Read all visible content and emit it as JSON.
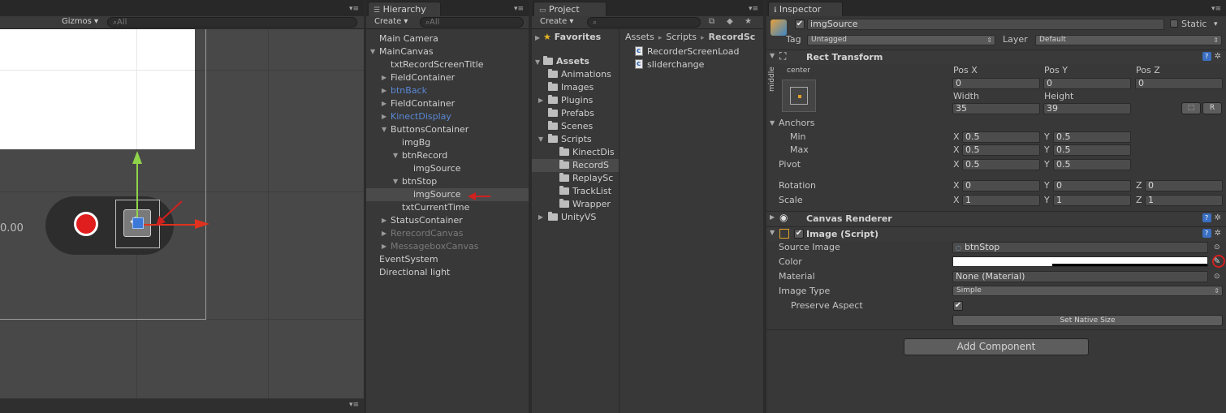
{
  "scene": {
    "gizmos_label": "Gizmos",
    "search_placeholder": "All",
    "time_text": "0.00"
  },
  "hierarchy": {
    "tab_label": "Hierarchy",
    "create_label": "Create",
    "search_placeholder": "All",
    "items": [
      {
        "label": "Main Camera",
        "indent": 0,
        "arrow": "",
        "style": ""
      },
      {
        "label": "MainCanvas",
        "indent": 0,
        "arrow": "▼",
        "style": ""
      },
      {
        "label": "txtRecordScreenTitle",
        "indent": 1,
        "arrow": "",
        "style": ""
      },
      {
        "label": "FieldContainer",
        "indent": 1,
        "arrow": "▶",
        "style": ""
      },
      {
        "label": "btnBack",
        "indent": 1,
        "arrow": "▶",
        "style": "blue"
      },
      {
        "label": "FieldContainer",
        "indent": 1,
        "arrow": "▶",
        "style": ""
      },
      {
        "label": "KinectDisplay",
        "indent": 1,
        "arrow": "▶",
        "style": "blue"
      },
      {
        "label": "ButtonsContainer",
        "indent": 1,
        "arrow": "▼",
        "style": ""
      },
      {
        "label": "imgBg",
        "indent": 2,
        "arrow": "",
        "style": ""
      },
      {
        "label": "btnRecord",
        "indent": 2,
        "arrow": "▼",
        "style": ""
      },
      {
        "label": "imgSource",
        "indent": 3,
        "arrow": "",
        "style": ""
      },
      {
        "label": "btnStop",
        "indent": 2,
        "arrow": "▼",
        "style": ""
      },
      {
        "label": "imgSource",
        "indent": 3,
        "arrow": "",
        "style": "selected"
      },
      {
        "label": "txtCurrentTime",
        "indent": 2,
        "arrow": "",
        "style": ""
      },
      {
        "label": "StatusContainer",
        "indent": 1,
        "arrow": "▶",
        "style": ""
      },
      {
        "label": "RerecordCanvas",
        "indent": 1,
        "arrow": "▶",
        "style": "dim"
      },
      {
        "label": "MessageboxCanvas",
        "indent": 1,
        "arrow": "▶",
        "style": "dim"
      },
      {
        "label": "EventSystem",
        "indent": 0,
        "arrow": "",
        "style": ""
      },
      {
        "label": "Directional light",
        "indent": 0,
        "arrow": "",
        "style": ""
      }
    ]
  },
  "project": {
    "tab_label": "Project",
    "create_label": "Create",
    "favorites_label": "Favorites",
    "assets_label": "Assets",
    "folders": [
      {
        "label": "Animations",
        "indent": 1,
        "arrow": ""
      },
      {
        "label": "Images",
        "indent": 1,
        "arrow": ""
      },
      {
        "label": "Plugins",
        "indent": 1,
        "arrow": "▶"
      },
      {
        "label": "Prefabs",
        "indent": 1,
        "arrow": ""
      },
      {
        "label": "Scenes",
        "indent": 1,
        "arrow": ""
      },
      {
        "label": "Scripts",
        "indent": 1,
        "arrow": "▼"
      },
      {
        "label": "KinectDis",
        "indent": 2,
        "arrow": ""
      },
      {
        "label": "RecordS",
        "indent": 2,
        "arrow": "",
        "selected": true
      },
      {
        "label": "ReplaySc",
        "indent": 2,
        "arrow": ""
      },
      {
        "label": "TrackList",
        "indent": 2,
        "arrow": ""
      },
      {
        "label": "Wrapper",
        "indent": 2,
        "arrow": ""
      },
      {
        "label": "UnityVS",
        "indent": 1,
        "arrow": "▶"
      }
    ],
    "breadcrumb": [
      "Assets",
      "Scripts",
      "RecordSc"
    ],
    "files": [
      "RecorderScreenLoad",
      "sliderchange"
    ]
  },
  "inspector": {
    "tab_label": "Inspector",
    "object_name": "imgSource",
    "static_label": "Static",
    "tag_label": "Tag",
    "tag_value": "Untagged",
    "layer_label": "Layer",
    "layer_value": "Default",
    "rect_transform": {
      "title": "Rect Transform",
      "anchor_h": "center",
      "anchor_v": "middle",
      "pos_x_label": "Pos X",
      "pos_y_label": "Pos Y",
      "pos_z_label": "Pos Z",
      "pos_x": "0",
      "pos_y": "0",
      "pos_z": "0",
      "width_label": "Width",
      "height_label": "Height",
      "width": "35",
      "height": "39",
      "r_button": "R",
      "anchors_label": "Anchors",
      "min_label": "Min",
      "max_label": "Max",
      "min_x": "0.5",
      "min_y": "0.5",
      "max_x": "0.5",
      "max_y": "0.5",
      "pivot_label": "Pivot",
      "pivot_x": "0.5",
      "pivot_y": "0.5",
      "rotation_label": "Rotation",
      "rot_x": "0",
      "rot_y": "0",
      "rot_z": "0",
      "scale_label": "Scale",
      "scale_x": "1",
      "scale_y": "1",
      "scale_z": "1",
      "x": "X",
      "y": "Y",
      "z": "Z"
    },
    "canvas_renderer": {
      "title": "Canvas Renderer"
    },
    "image": {
      "title": "Image (Script)",
      "source_image_label": "Source Image",
      "source_image_value": "btnStop",
      "color_label": "Color",
      "material_label": "Material",
      "material_value": "None (Material)",
      "image_type_label": "Image Type",
      "image_type_value": "Simple",
      "preserve_aspect_label": "Preserve Aspect",
      "set_native_size": "Set Native Size"
    },
    "add_component": "Add Component"
  },
  "colors": {
    "selection_arrow": "#d02020",
    "link_blue": "#5a88d6",
    "record_red": "#e01e1e"
  }
}
